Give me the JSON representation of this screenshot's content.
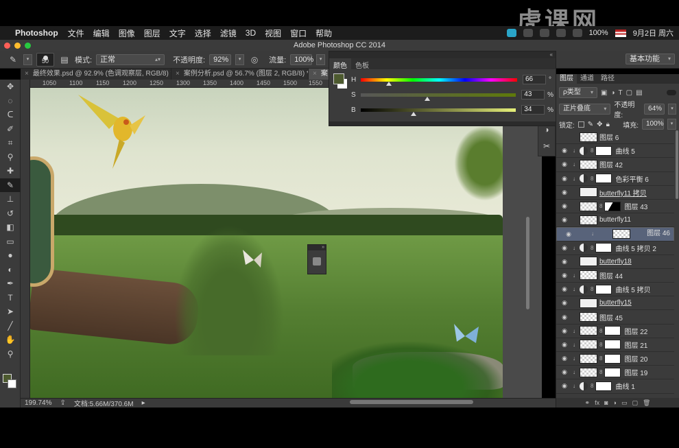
{
  "menubar": {
    "app": "Photoshop",
    "items": [
      "文件",
      "编辑",
      "图像",
      "图层",
      "文字",
      "选择",
      "滤镜",
      "3D",
      "视图",
      "窗口",
      "帮助"
    ],
    "battery": "100%",
    "clock": "9月2日 周六"
  },
  "window": {
    "title": "Adobe Photoshop CC 2014"
  },
  "options": {
    "brush_size": "50",
    "mode_label": "模式:",
    "mode_value": "正常",
    "opacity_label": "不透明度:",
    "opacity_value": "92%",
    "flow_label": "流量:",
    "flow_value": "100%",
    "workspace": "基本功能"
  },
  "doc_tabs": [
    {
      "label": "最终效果.psd @ 92.9% (色调观察层, RGB/8) *",
      "active": false
    },
    {
      "label": "案例分析.psd @ 56.7% (图层 2, RGB/8) *",
      "active": false
    },
    {
      "label": "案",
      "active": true
    }
  ],
  "ruler": {
    "marks": [
      "1050",
      "1100",
      "1150",
      "1200",
      "1250",
      "1300",
      "1350",
      "1400",
      "1450",
      "1500",
      "1550"
    ]
  },
  "color_panel": {
    "tabs": [
      "颜色",
      "色板"
    ],
    "channels": [
      {
        "name": "H",
        "value": "66",
        "unit": "°",
        "pos": 0.18
      },
      {
        "name": "S",
        "value": "43",
        "unit": "%",
        "pos": 0.43
      },
      {
        "name": "B",
        "value": "34",
        "unit": "%",
        "pos": 0.34
      }
    ],
    "fg_color": "#4d5a2f"
  },
  "layers_panel": {
    "tabs": [
      "图层",
      "通道",
      "路径"
    ],
    "filter_type": "ρ类型",
    "blend_mode": "正片叠底",
    "opacity_label": "不透明度:",
    "opacity_value": "64%",
    "lock_label": "锁定:",
    "fill_label": "填充:",
    "fill_value": "100%",
    "layers": [
      {
        "name": "图层 6",
        "visible": false,
        "clip": false,
        "kind": "pixel"
      },
      {
        "name": "曲线 5",
        "visible": true,
        "clip": true,
        "kind": "adjust"
      },
      {
        "name": "图层 42",
        "visible": true,
        "clip": true,
        "kind": "pixel"
      },
      {
        "name": "色彩平衡 6",
        "visible": true,
        "clip": true,
        "kind": "adjust"
      },
      {
        "name": "butterfly11 拷贝",
        "visible": true,
        "clip": false,
        "kind": "smart"
      },
      {
        "name": "图层 43",
        "visible": true,
        "clip": false,
        "kind": "masked"
      },
      {
        "name": "butterfly11",
        "visible": true,
        "clip": false,
        "kind": "pixel"
      },
      {
        "name": "图层 46",
        "visible": true,
        "clip": true,
        "kind": "pixel",
        "selected": true
      },
      {
        "name": "曲线 5 拷贝 2",
        "visible": true,
        "clip": true,
        "kind": "adjust"
      },
      {
        "name": "butterfly18",
        "visible": true,
        "clip": false,
        "kind": "smart"
      },
      {
        "name": "图层 44",
        "visible": true,
        "clip": true,
        "kind": "pixel"
      },
      {
        "name": "曲线 5 拷贝",
        "visible": true,
        "clip": true,
        "kind": "adjust"
      },
      {
        "name": "butterfly15",
        "visible": true,
        "clip": false,
        "kind": "smart"
      },
      {
        "name": "图层 45",
        "visible": true,
        "clip": false,
        "kind": "pixel"
      },
      {
        "name": "图层 22",
        "visible": true,
        "clip": true,
        "kind": "masked"
      },
      {
        "name": "图层 21",
        "visible": true,
        "clip": true,
        "kind": "masked"
      },
      {
        "name": "图层 20",
        "visible": true,
        "clip": true,
        "kind": "masked"
      },
      {
        "name": "图层 19",
        "visible": true,
        "clip": true,
        "kind": "masked"
      },
      {
        "name": "曲线 1",
        "visible": true,
        "clip": true,
        "kind": "adjust"
      }
    ]
  },
  "status": {
    "zoom": "199.74%",
    "doc": "文档:5.66M/370.6M"
  },
  "watermark": "虎课网"
}
